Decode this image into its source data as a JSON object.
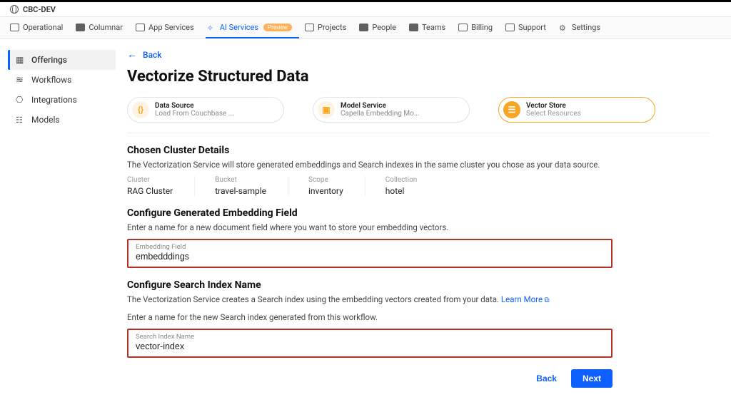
{
  "brand": {
    "name": "CBC-DEV"
  },
  "nav": {
    "items": [
      {
        "label": "Operational"
      },
      {
        "label": "Columnar"
      },
      {
        "label": "App Services"
      },
      {
        "label": "AI Services",
        "active": true,
        "preview": "Preview"
      },
      {
        "label": "Projects"
      },
      {
        "label": "People"
      },
      {
        "label": "Teams"
      },
      {
        "label": "Billing"
      },
      {
        "label": "Support"
      },
      {
        "label": "Settings"
      }
    ]
  },
  "sidebar": {
    "items": [
      {
        "label": "Offerings",
        "active": true
      },
      {
        "label": "Workflows"
      },
      {
        "label": "Integrations"
      },
      {
        "label": "Models"
      }
    ]
  },
  "back_label": "Back",
  "page_title": "Vectorize Structured Data",
  "steps": [
    {
      "title": "Data Source",
      "sub": "Load From Couchbase ..."
    },
    {
      "title": "Model Service",
      "sub": "Capella Embedding Mo..."
    },
    {
      "title": "Vector Store",
      "sub": "Select Resources"
    }
  ],
  "cluster_section": {
    "heading": "Chosen Cluster Details",
    "desc": "The Vectorization Service will store generated embeddings and Search indexes in the same cluster you chose as your data source.",
    "fields": [
      {
        "label": "Cluster",
        "value": "RAG Cluster"
      },
      {
        "label": "Bucket",
        "value": "travel-sample"
      },
      {
        "label": "Scope",
        "value": "inventory"
      },
      {
        "label": "Collection",
        "value": "hotel"
      }
    ]
  },
  "embedding_section": {
    "heading": "Configure Generated Embedding Field",
    "desc": "Enter a name for a new document field where you want to store your embedding vectors.",
    "field_label": "Embedding Field",
    "field_value": "embedddings"
  },
  "index_section": {
    "heading": "Configure Search Index Name",
    "desc1": "The Vectorization Service creates a Search index using the embedding vectors created from your data.",
    "learn_more": "Learn More",
    "desc2": "Enter a name for the new Search index generated from this workflow.",
    "field_label": "Search Index Name",
    "field_value": "vector-index"
  },
  "footer": {
    "back": "Back",
    "next": "Next"
  }
}
